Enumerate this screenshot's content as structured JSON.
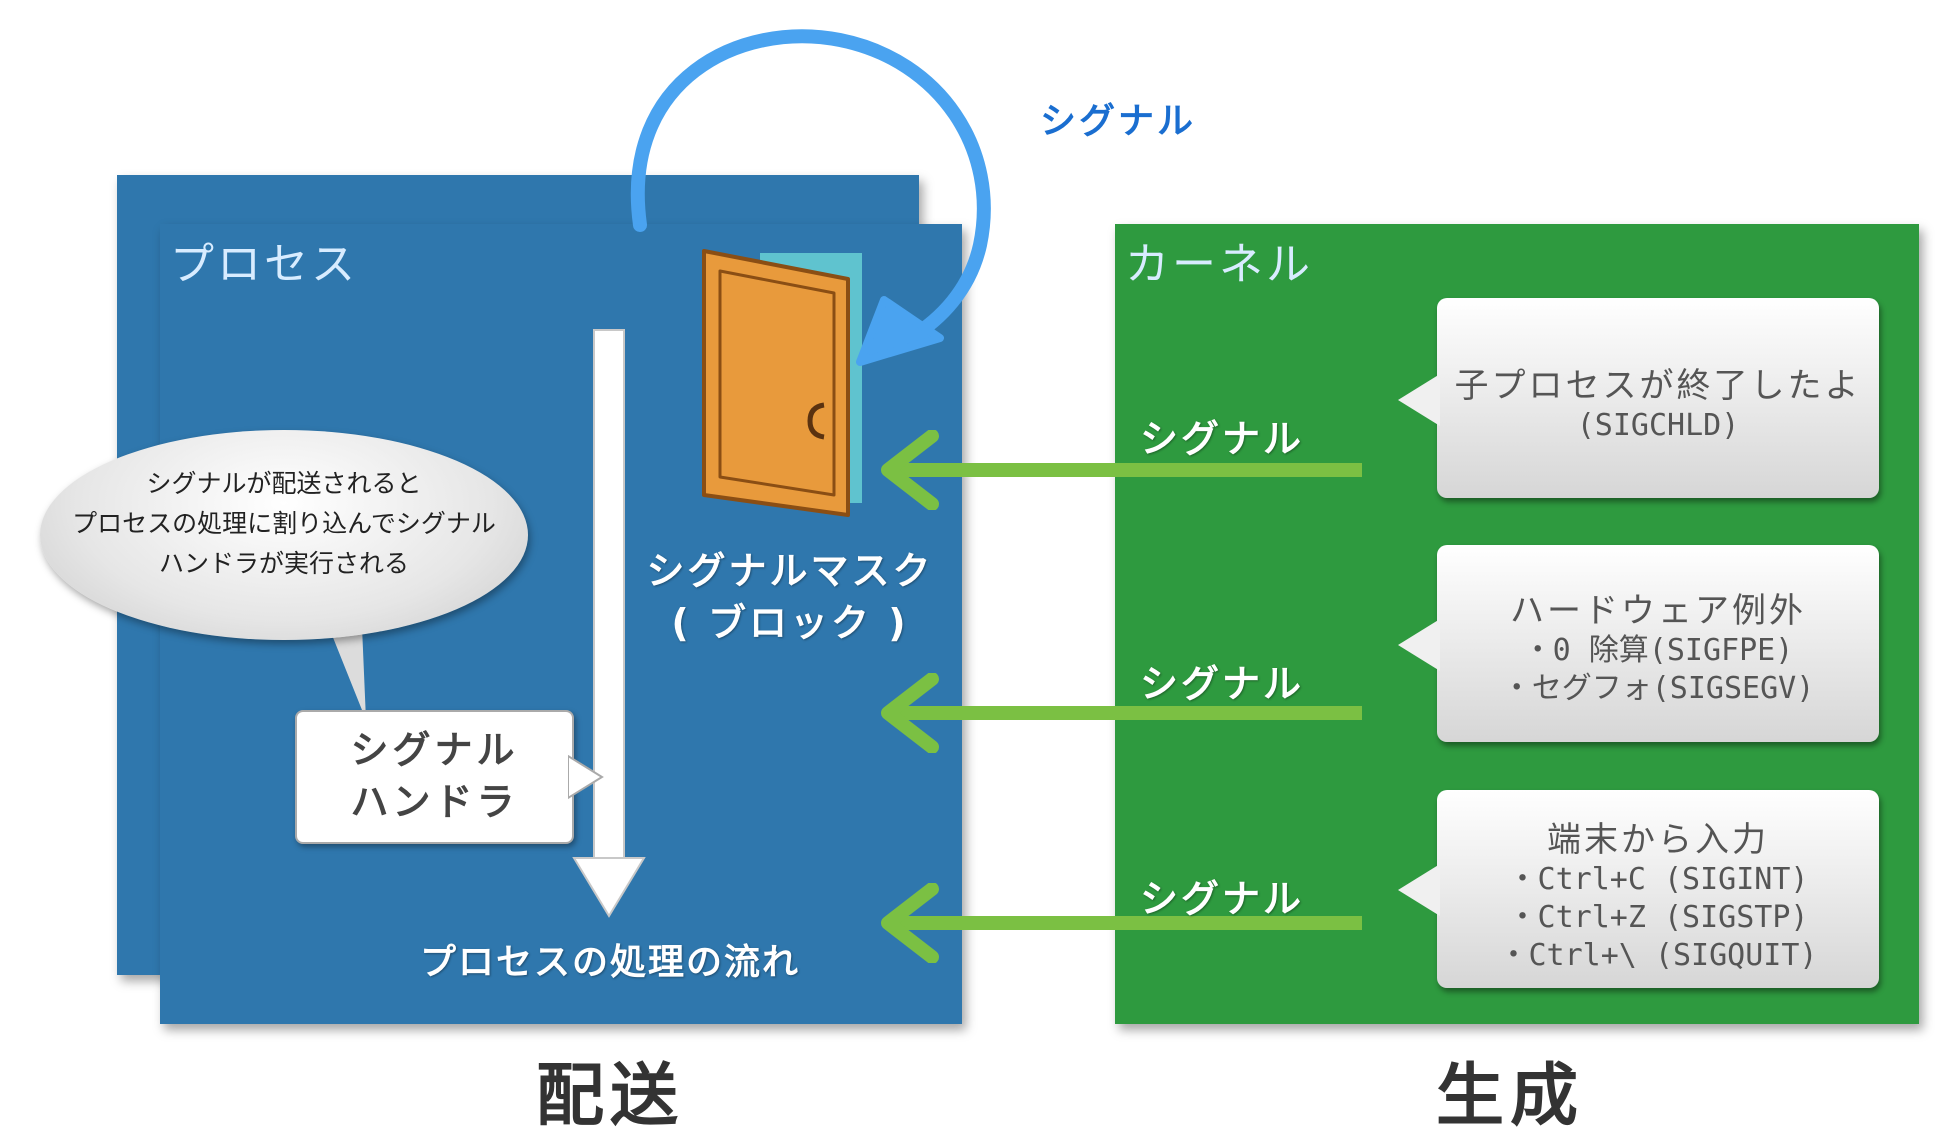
{
  "process": {
    "title": "プロセス",
    "mask_label_1": "シグナルマスク",
    "mask_label_2": "( ブロック )",
    "flow_label": "プロセスの処理の流れ",
    "bubble_lines": [
      "シグナルが配送されると",
      "プロセスの処理に割り込んでシグナル",
      "ハンドラが実行される"
    ],
    "handler_lines": [
      "シグナル",
      "ハンドラ"
    ]
  },
  "kernel": {
    "title": "カーネル"
  },
  "top_signal": "シグナル",
  "signals": [
    {
      "label": "シグナル",
      "callout_title": "子プロセスが終了したよ",
      "callout_lines": [
        "(SIGCHLD)"
      ]
    },
    {
      "label": "シグナル",
      "callout_title": "ハードウェア例外",
      "callout_lines": [
        "・0 除算(SIGFPE)",
        "・セグフォ(SIGSEGV)"
      ]
    },
    {
      "label": "シグナル",
      "callout_title": "端末から入力",
      "callout_lines": [
        "・Ctrl+C (SIGINT)",
        "・Ctrl+Z (SIGSTP)",
        "・Ctrl+\\ (SIGQUIT)"
      ]
    }
  ],
  "footer": {
    "delivery": "配送",
    "generation": "生成"
  },
  "colors": {
    "process_blue": "#2f77ad",
    "kernel_green": "#2e9a3f",
    "arrow_green": "#7bc043",
    "arrow_blue": "#4aa3f0",
    "top_signal_text": "#1a6ed0"
  }
}
